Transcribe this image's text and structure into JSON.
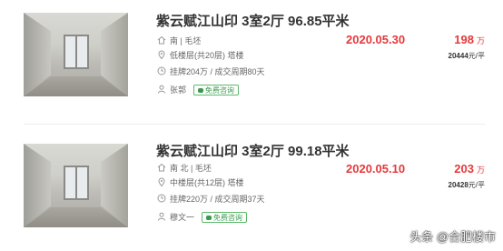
{
  "listings": [
    {
      "title": "紫云赋江山印 3室2厅 96.85平米",
      "orientation": "南 | 毛坯",
      "floor": "低楼层(共20层) 塔楼",
      "listing_info": "挂牌204万 / 成交周期80天",
      "agent": "张郭",
      "consult_label": "免费咨询",
      "deal_date": "2020.05.30",
      "price": "198",
      "price_unit": "万",
      "unit_price_value": "20444",
      "unit_price_suffix": "元/平"
    },
    {
      "title": "紫云赋江山印 3室2厅 99.18平米",
      "orientation": "南 北 | 毛坯",
      "floor": "中楼层(共12层) 塔楼",
      "listing_info": "挂牌220万 / 成交周期37天",
      "agent": "穆文一",
      "consult_label": "免费咨询",
      "deal_date": "2020.05.10",
      "price": "203",
      "price_unit": "万",
      "unit_price_value": "20428",
      "unit_price_suffix": "元/平"
    }
  ],
  "watermark": "头条 @合肥楼市",
  "colors": {
    "accent_red": "#e4393c",
    "consult_green": "#3a9a4b",
    "text_gray": "#666666"
  },
  "icons": [
    "home-icon",
    "location-icon",
    "tag-icon",
    "person-icon",
    "chat-icon"
  ]
}
